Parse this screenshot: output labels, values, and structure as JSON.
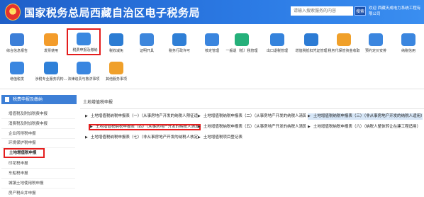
{
  "header": {
    "title": "国家税务总局西藏自治区电子税务局",
    "search_placeholder": "请输入搜索服务的内容",
    "search_button": "搜索",
    "user_info": "欢迎 西藏天成电力系统工程有限公司"
  },
  "menu": {
    "items": [
      {
        "label": "综合信息报告",
        "icon": "info-report-icon",
        "color": "#3c7fd8"
      },
      {
        "label": "发票使用",
        "icon": "invoice-icon",
        "color": "#f39c2b"
      },
      {
        "label": "税费申报及缴纳",
        "icon": "tax-declare-icon",
        "color": "#3a88e0"
      },
      {
        "label": "税收减免",
        "icon": "tax-reduction-icon",
        "color": "#2b7cd3"
      },
      {
        "label": "证明开具",
        "icon": "certificate-icon",
        "color": "#3d86dc"
      },
      {
        "label": "税务行政许可",
        "icon": "admin-permit-icon",
        "color": "#2f7fd6"
      },
      {
        "label": "核定管理",
        "icon": "verify-manage-icon",
        "color": "#3a85de"
      },
      {
        "label": "一般退（抵）税管理",
        "icon": "refund-icon",
        "color": "#25b07a"
      },
      {
        "label": "出口退税管理",
        "icon": "export-refund-icon",
        "color": "#3583dc"
      },
      {
        "label": "增值税抵扣凭证管理",
        "icon": "vat-deduction-icon",
        "color": "#2c7bd4"
      },
      {
        "label": "税务代保管资金收取",
        "icon": "fund-custody-icon",
        "color": "#f0a02a"
      },
      {
        "label": "预约定价安排",
        "icon": "pricing-icon",
        "color": "#3b86df"
      },
      {
        "label": "纳税信用",
        "icon": "credit-icon",
        "color": "#3b86df"
      },
      {
        "label": "增值税发",
        "icon": "vat-invoice-icon",
        "color": "#3a86e0"
      },
      {
        "label": "涉税专业服务机构…",
        "icon": "agency-icon",
        "color": "#2f80d8"
      },
      {
        "label": "法律追责与救济事项",
        "icon": "legal-icon",
        "color": "#3a86e0"
      },
      {
        "label": "其他服务事项",
        "icon": "other-service-icon",
        "color": "#f0a02a"
      }
    ]
  },
  "sidebar": {
    "header": "税费申报及缴纳",
    "items": [
      {
        "label": "增值税及附加税费申报"
      },
      {
        "label": "消费税及附加税费申报"
      },
      {
        "label": "企业所得税申报"
      },
      {
        "label": "环境保护税申报"
      },
      {
        "label": "土地增值税申报"
      },
      {
        "label": "印花税申报"
      },
      {
        "label": "车船税申报"
      },
      {
        "label": "城镇土地使用税申报"
      },
      {
        "label": "房产税合并申报"
      }
    ]
  },
  "content": {
    "title": "土地增值税申报",
    "forms": [
      "土地增值税纳税申报表（一）（从事房地产开发的纳税人预征适…",
      "土地增值税纳税申报表（二）（从事房地产开发的纳税人清算适…",
      "土地增值税纳税申报表（三）（非从事房地产开发的纳税人适用）",
      "土地增值税纳税申报表（四）（从事房地产开发的纳税人清算后…",
      "土地增值税纳税申报表（五）（从事房地产开发的纳税人清算方…",
      "土地增值税纳税申报表（六）（纳税人整体转让在建工程适用）",
      "土地增值税纳税申报表（七）（非从事房地产开发的纳税人核定…",
      "土地增值税项目登记表"
    ]
  }
}
